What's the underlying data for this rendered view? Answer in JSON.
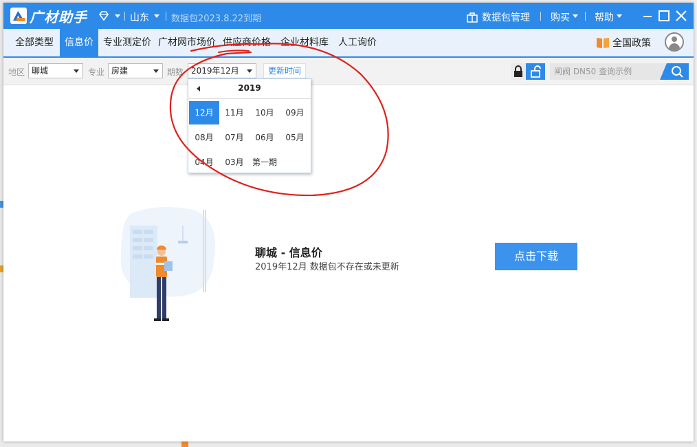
{
  "app": {
    "name": "广材助手",
    "region": "山东",
    "expire_notice": "数据包2023.8.22到期",
    "package_manage": "数据包管理",
    "buy": "购买",
    "help": "帮助"
  },
  "tabs": [
    {
      "label": "全部类型"
    },
    {
      "label": "信息价"
    },
    {
      "label": "专业测定价"
    },
    {
      "label": "广材网市场价"
    },
    {
      "label": "供应商价格"
    },
    {
      "label": "企业材料库"
    },
    {
      "label": "人工询价"
    }
  ],
  "policy": "全国政策",
  "filters": {
    "area_label": "地区",
    "area_value": "聊城",
    "major_label": "专业",
    "major_value": "房建",
    "period_label": "期数",
    "period_value": "2019年12月",
    "update_button": "更新时间"
  },
  "search": {
    "placeholder": "闸阀 DN50 查询示例"
  },
  "picker": {
    "year": "2019",
    "months": [
      "12月",
      "11月",
      "10月",
      "09月",
      "08月",
      "07月",
      "06月",
      "05月",
      "04月",
      "03月",
      "第一期"
    ],
    "selected": "12月"
  },
  "empty_state": {
    "title": "聊城 - 信息价",
    "subtitle": "2019年12月 数据包不存在或未更新",
    "download_button": "点击下载"
  },
  "colors": {
    "primary": "#2e8ae8",
    "annotation": "#e0201a",
    "download": "#3b93ee"
  }
}
